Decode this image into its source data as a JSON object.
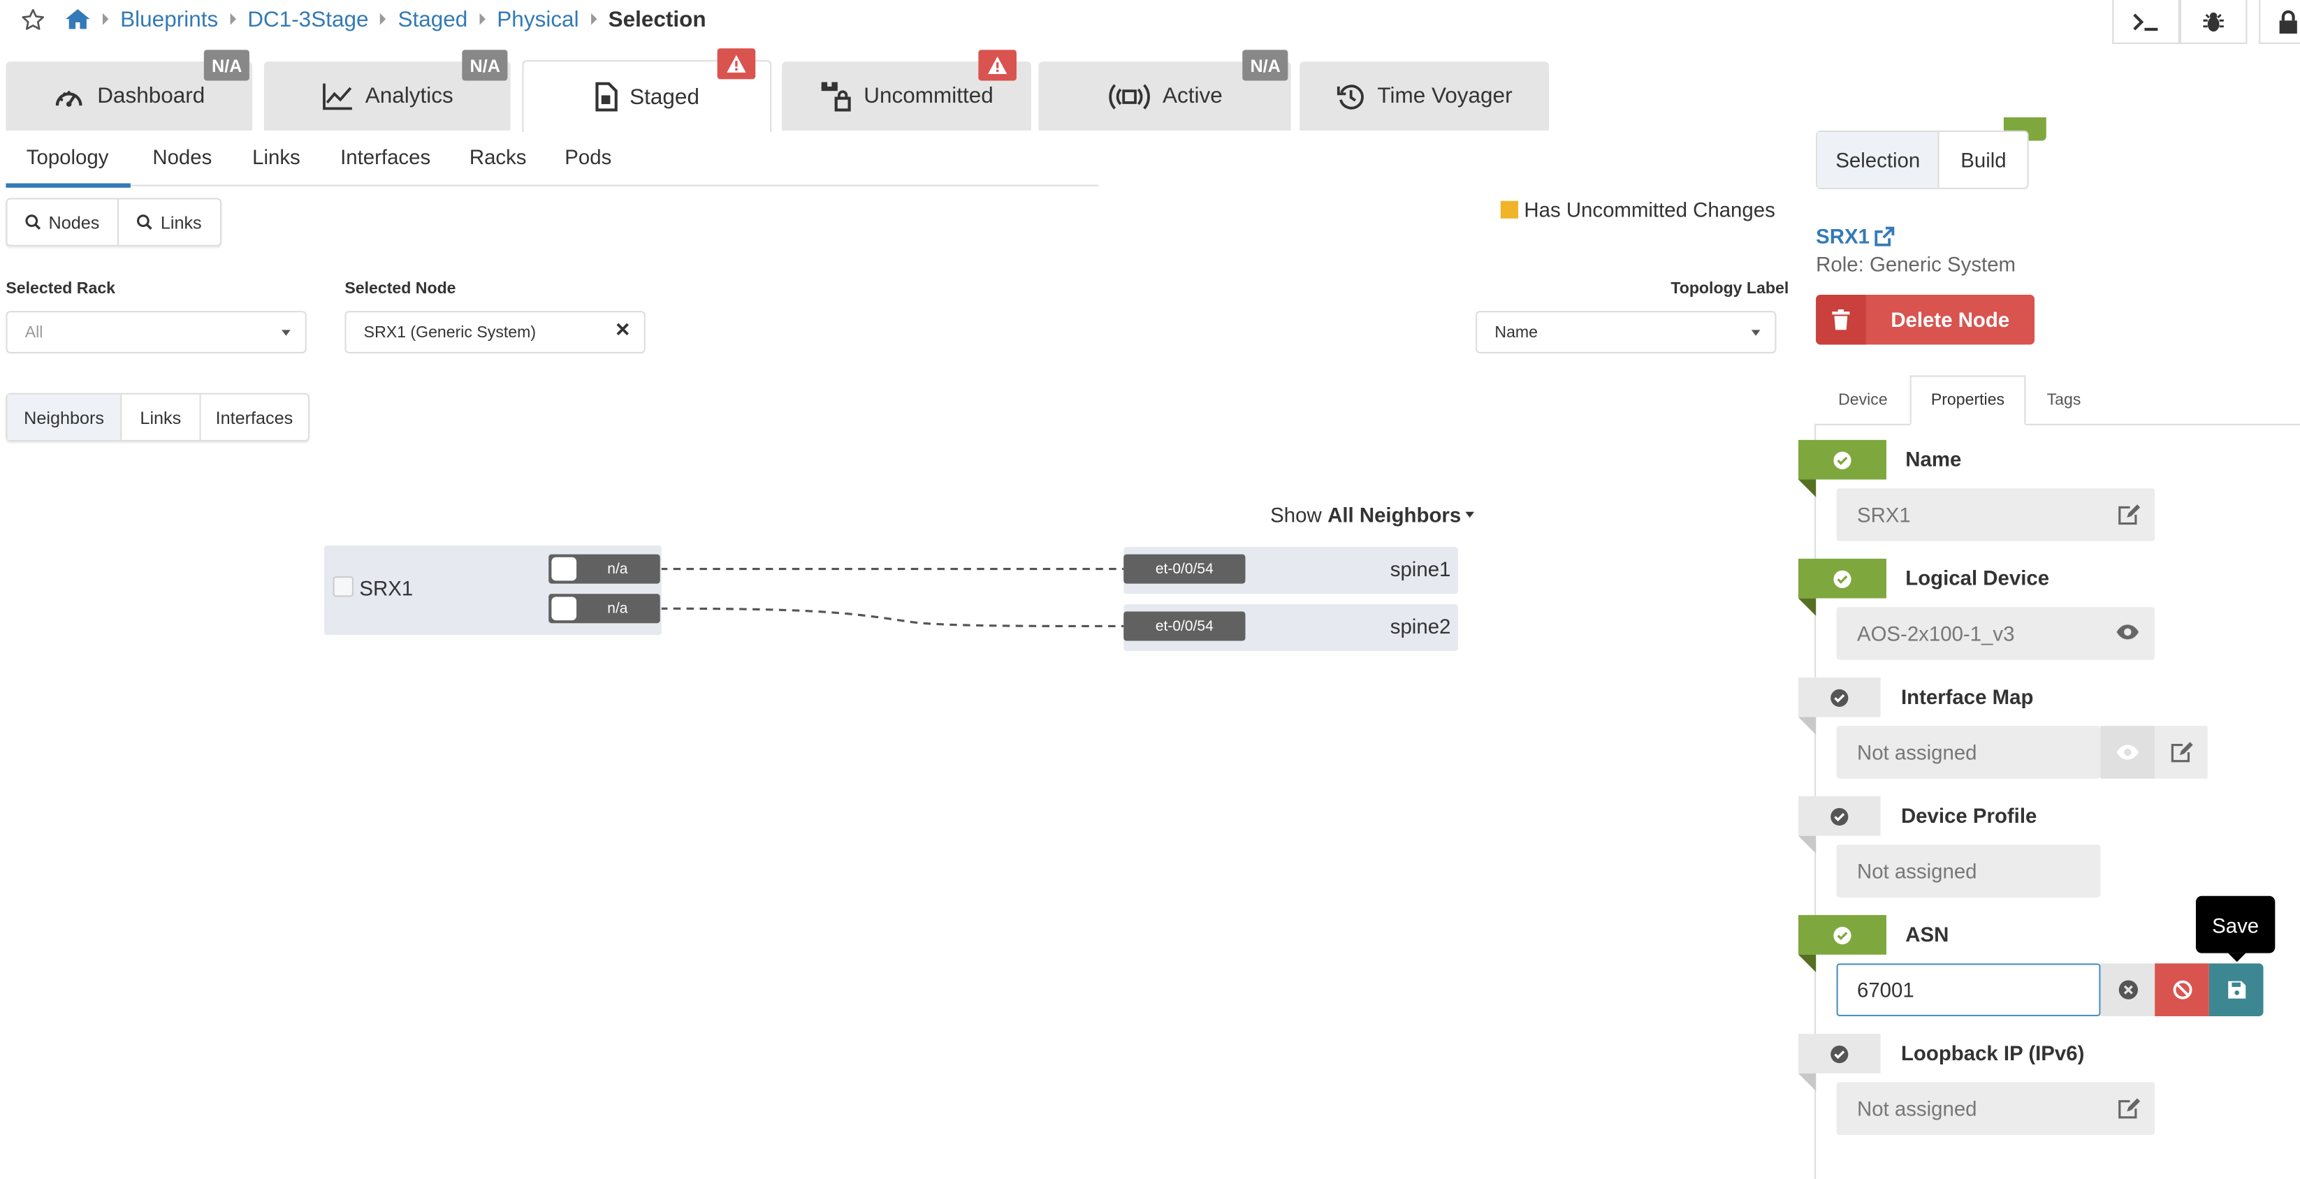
{
  "breadcrumb": {
    "items": [
      "Blueprints",
      "DC1-3Stage",
      "Staged",
      "Physical"
    ],
    "current": "Selection"
  },
  "main_tabs": [
    {
      "label": "Dashboard",
      "badge": "N/A",
      "icon": "dashboard-gauge-icon"
    },
    {
      "label": "Analytics",
      "badge": "N/A",
      "icon": "line-chart-icon"
    },
    {
      "label": "Staged",
      "badge": "warning",
      "icon": "staged-document-icon",
      "active": true
    },
    {
      "label": "Uncommitted",
      "badge": "warning",
      "icon": "uncommitted-icon"
    },
    {
      "label": "Active",
      "badge": "N/A",
      "icon": "broadcast-icon"
    },
    {
      "label": "Time Voyager",
      "icon": "history-icon"
    }
  ],
  "sub_tabs": [
    "Topology",
    "Nodes",
    "Links",
    "Interfaces",
    "Racks",
    "Pods"
  ],
  "search_buttons": [
    "Nodes",
    "Links"
  ],
  "legend": {
    "uncommitted": "Has Uncommitted Changes",
    "color": "#f0b429"
  },
  "filters": {
    "rack_label": "Selected Rack",
    "rack_value": "All",
    "node_label": "Selected Node",
    "node_value": "SRX1 (Generic System)",
    "topology_label": "Topology Label",
    "topology_value": "Name"
  },
  "view_buttons": [
    "Neighbors",
    "Links",
    "Interfaces"
  ],
  "topology": {
    "show_prefix": "Show",
    "show_value": "All Neighbors",
    "source": {
      "name": "SRX1",
      "ports": [
        "n/a",
        "n/a"
      ]
    },
    "neighbors": [
      {
        "name": "spine1",
        "port": "et-0/0/54"
      },
      {
        "name": "spine2",
        "port": "et-0/0/54"
      }
    ]
  },
  "panel": {
    "tabs": [
      "Selection",
      "Build"
    ],
    "node_name": "SRX1",
    "role": "Role: Generic System",
    "delete_label": "Delete Node",
    "prop_tabs": [
      "Device",
      "Properties",
      "Tags"
    ],
    "properties": [
      {
        "title": "Name",
        "value": "SRX1",
        "status": "ok"
      },
      {
        "title": "Logical Device",
        "value": "AOS-2x100-1_v3",
        "status": "ok"
      },
      {
        "title": "Interface Map",
        "value": "Not assigned",
        "status": "neutral"
      },
      {
        "title": "Device Profile",
        "value": "Not assigned",
        "status": "neutral"
      },
      {
        "title": "ASN",
        "value": "67001",
        "status": "ok"
      },
      {
        "title": "Loopback IP (IPv6)",
        "value": "Not assigned",
        "status": "neutral"
      }
    ],
    "save_tooltip": "Save"
  },
  "colors": {
    "link": "#337ab7",
    "ok": "#7ea83d",
    "danger": "#d9534f",
    "save": "#3c8791",
    "warning": "#f0b429"
  }
}
